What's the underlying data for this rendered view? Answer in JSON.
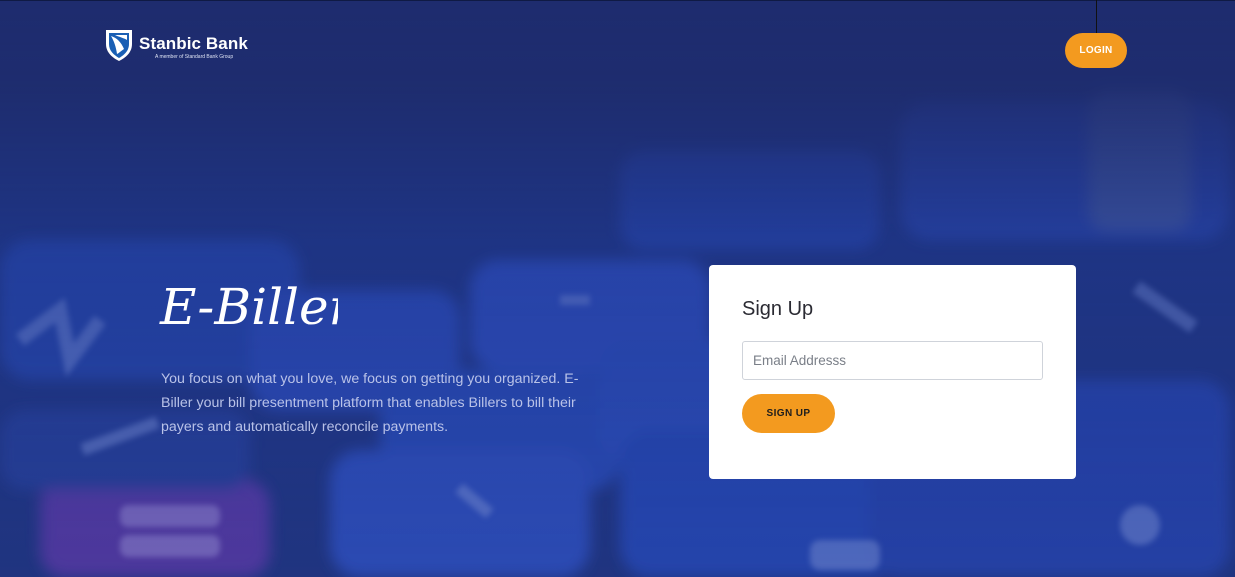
{
  "header": {
    "brand_name": "Stanbic Bank",
    "brand_tagline": "A member of Standard Bank Group",
    "login_label": "LOGIN"
  },
  "hero": {
    "title": "E-Biller",
    "description": "You focus on what you love, we focus on getting you organized. E-Biller your bill presentment platform that enables Billers to bill their payers and automatically reconcile payments."
  },
  "signup": {
    "title": "Sign Up",
    "email_placeholder": "Email Addresss",
    "email_value": "",
    "submit_label": "SIGN UP"
  },
  "colors": {
    "background": "#1f2f6e",
    "accent": "#f39a1f",
    "card": "#ffffff"
  }
}
